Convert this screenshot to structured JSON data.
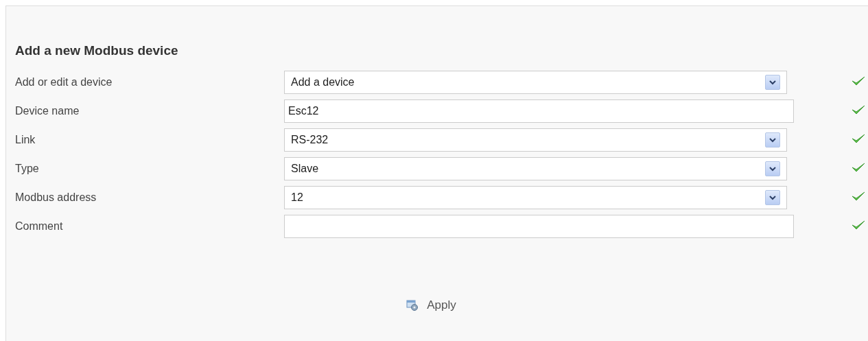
{
  "title": "Add a new Modbus device",
  "fields": [
    {
      "label": "Add or edit a device",
      "kind": "select",
      "value": "Add a device",
      "valid": true
    },
    {
      "label": "Device name",
      "kind": "text",
      "value": "Esc12",
      "valid": true
    },
    {
      "label": "Link",
      "kind": "select",
      "value": "RS-232",
      "valid": true
    },
    {
      "label": "Type",
      "kind": "select",
      "value": "Slave",
      "valid": true
    },
    {
      "label": "Modbus address",
      "kind": "select",
      "value": "12",
      "valid": true
    },
    {
      "label": "Comment",
      "kind": "text",
      "valid": true
    }
  ],
  "apply_button": "Apply"
}
